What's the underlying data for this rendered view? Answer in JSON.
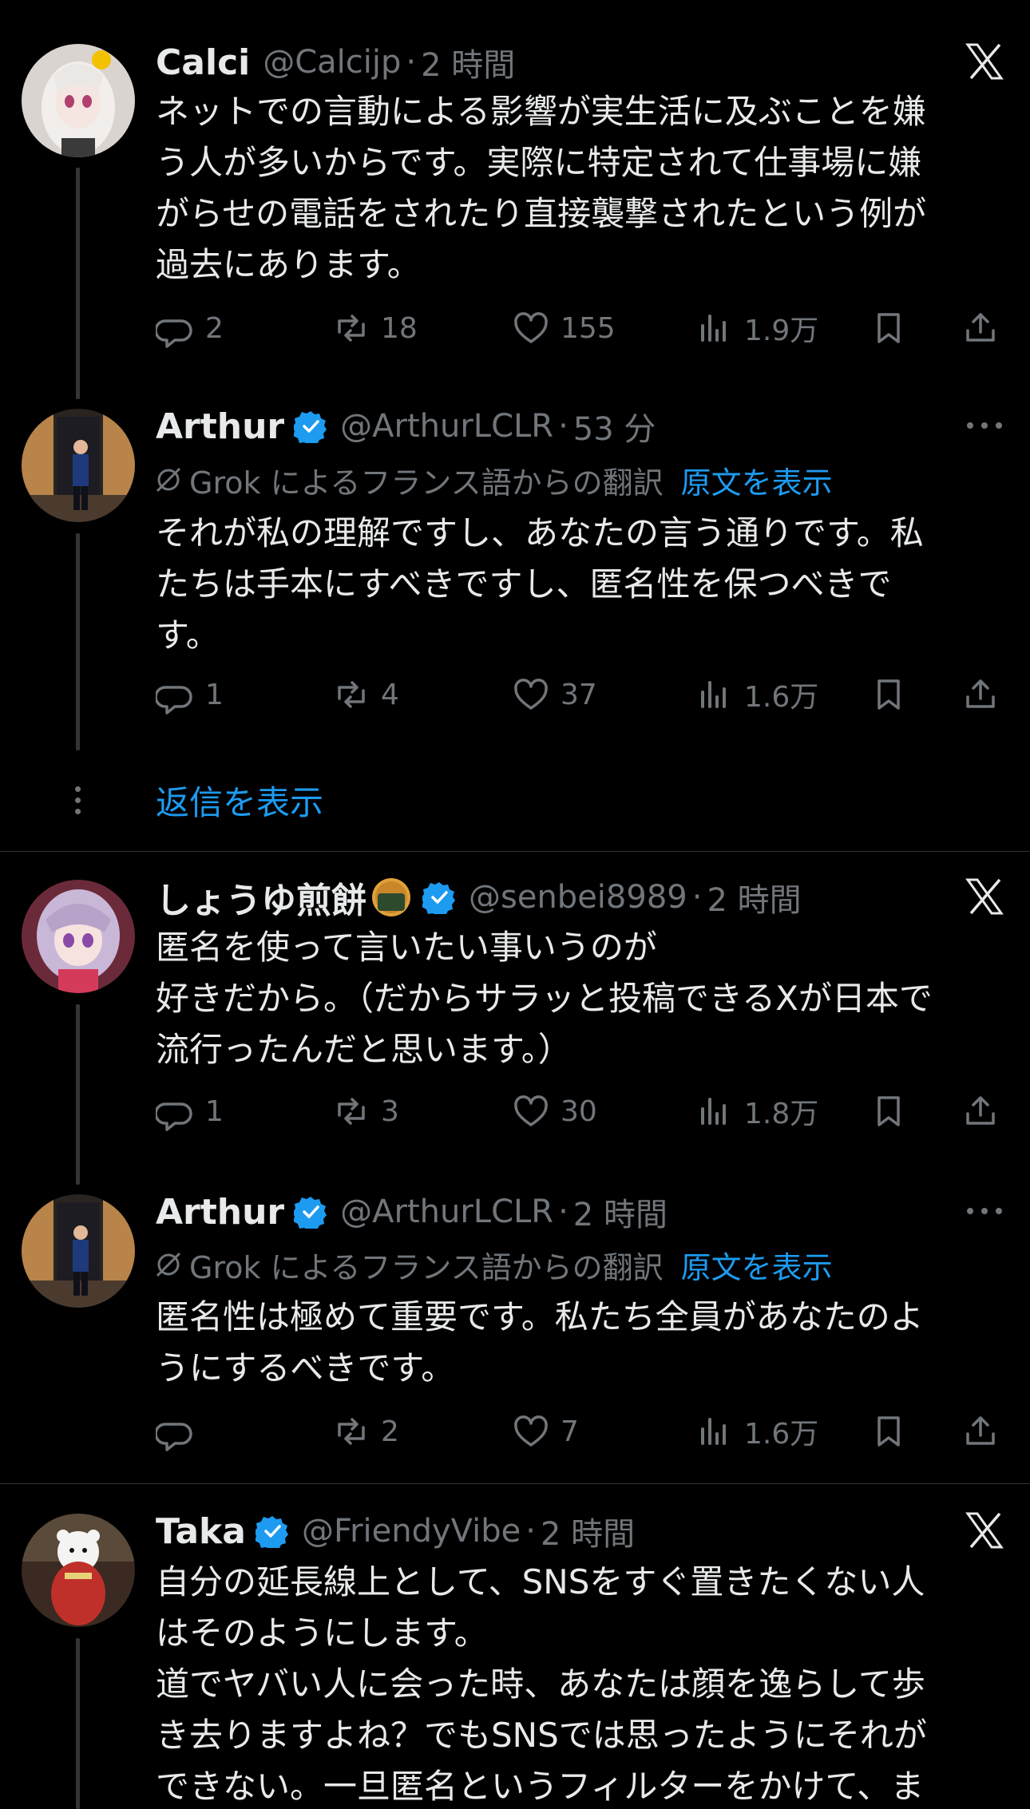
{
  "tweets": [
    {
      "name": "Calci",
      "handle": "@Calcijp",
      "dot": "·",
      "time": "2 時間",
      "lines": [
        "ネットでの言動による影響が実生活に及ぶことを嫌",
        "う人が多いからです。実際に特定されて仕事場に嫌",
        "がらせの電話をされたり直接襲撃されたという例が",
        "過去にあります。"
      ],
      "replies": "2",
      "retweets": "18",
      "likes": "155",
      "views": "1.9万",
      "corner_icon": "x-logo-icon"
    },
    {
      "name": "Arthur",
      "handle": "@ArthurLCLR",
      "dot": "·",
      "time": "53 分",
      "translation_label": "Grok によるフランス語からの翻訳",
      "translation_link": "原文を表示",
      "lines": [
        "それが私の理解ですし、あなたの言う通りです。私",
        "たちは手本にすべきですし、匿名性を保つべきで",
        "す。"
      ],
      "replies": "1",
      "retweets": "4",
      "likes": "37",
      "views": "1.6万",
      "corner_icon": "more-icon"
    },
    {
      "name": "しょうゆ煎餅",
      "handle": "@senbei8989",
      "dot": "·",
      "time": "2 時間",
      "lines": [
        "匿名を使って言いたい事いうのが",
        "好きだから。（だからサラッと投稿できるXが日本で",
        "流行ったんだと思います。）"
      ],
      "replies": "1",
      "retweets": "3",
      "likes": "30",
      "views": "1.8万",
      "corner_icon": "x-logo-icon"
    },
    {
      "name": "Arthur",
      "handle": "@ArthurLCLR",
      "dot": "·",
      "time": "2 時間",
      "translation_label": "Grok によるフランス語からの翻訳",
      "translation_link": "原文を表示",
      "lines": [
        "匿名性は極めて重要です。私たち全員があなたのよ",
        "うにするべきです。"
      ],
      "replies": "",
      "retweets": "2",
      "likes": "7",
      "views": "1.6万",
      "corner_icon": "more-icon"
    },
    {
      "name": "Taka",
      "handle": "@FriendyVibe",
      "dot": "·",
      "time": "2 時間",
      "lines": [
        "自分の延長線上として、SNSをすぐ置きたくない人",
        "はそのようにします。",
        "道でヤバい人に会った時、あなたは顔を逸らして歩",
        "き去りますよね？でもSNSでは思ったようにそれが",
        "できない。一旦匿名というフィルターをかけて、ま"
      ],
      "corner_icon": "x-logo-icon"
    }
  ],
  "show_replies": "返信を表示",
  "colors": {
    "background": "#000000",
    "text": "#e7e9ea",
    "muted": "#71767b",
    "link": "#1d9bf0",
    "verified": "#1d9bf0"
  }
}
